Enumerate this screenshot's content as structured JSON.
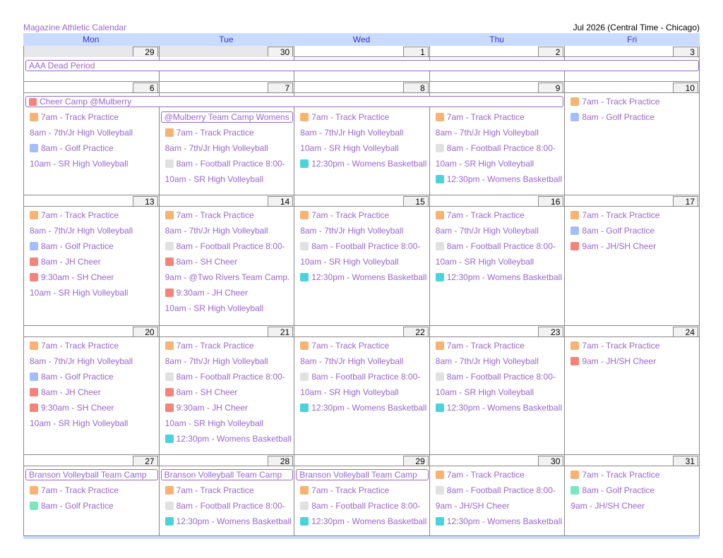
{
  "header": {
    "calendar_title": "Magazine Athletic Calendar",
    "month_label": "Jul 2026 (Central Time - Chicago)"
  },
  "days": [
    "Mon",
    "Tue",
    "Wed",
    "Thu",
    "Fri"
  ],
  "colors": {
    "orange": "#f8b273",
    "blue": "#a4bdfc",
    "gray": "#e1e1e1",
    "cyan": "#4bd3dc",
    "red": "#f4837a",
    "green": "#7ae7bf",
    "none": ""
  },
  "weeks": [
    {
      "dates": [
        "29",
        "30",
        "1",
        "2",
        "3"
      ],
      "other_month": [
        true,
        true,
        false,
        false,
        false
      ],
      "spans": [
        {
          "start": 0,
          "end": 4,
          "row": 0,
          "label": "AAA Dead Period",
          "color": "none"
        }
      ],
      "events": [
        [],
        [],
        [],
        [],
        []
      ]
    },
    {
      "dates": [
        "6",
        "7",
        "8",
        "9",
        "10"
      ],
      "other_month": [
        false,
        false,
        false,
        false,
        false
      ],
      "spans": [
        {
          "start": 0,
          "end": 3,
          "row": 0,
          "label": "Cheer Camp @Mulberry",
          "color": "red"
        },
        {
          "start": 1,
          "end": 1,
          "row": 1,
          "label": "@Mulberry Team Camp Womens",
          "color": "none"
        }
      ],
      "events": [
        [
          {
            "row": 1,
            "label": "7am - Track Practice",
            "color": "orange"
          },
          {
            "row": 2,
            "label": "8am - 7th/Jr High Volleyball",
            "color": "none"
          },
          {
            "row": 3,
            "label": "8am - Golf Practice",
            "color": "blue"
          },
          {
            "row": 4,
            "label": "10am - SR High Volleyball",
            "color": "none"
          }
        ],
        [
          {
            "row": 2,
            "label": "7am - Track Practice",
            "color": "orange"
          },
          {
            "row": 3,
            "label": "8am - 7th/Jr High Volleyball",
            "color": "none"
          },
          {
            "row": 4,
            "label": "8am - Football Practice 8:00-",
            "color": "gray"
          },
          {
            "row": 5,
            "label": "10am - SR High Volleyball",
            "color": "none"
          }
        ],
        [
          {
            "row": 1,
            "label": "7am - Track Practice",
            "color": "orange"
          },
          {
            "row": 2,
            "label": "8am - 7th/Jr High Volleyball",
            "color": "none"
          },
          {
            "row": 3,
            "label": "10am - SR High Volleyball",
            "color": "none"
          },
          {
            "row": 4,
            "label": "12:30pm - Womens Basketball",
            "color": "cyan"
          }
        ],
        [
          {
            "row": 1,
            "label": "7am - Track Practice",
            "color": "orange"
          },
          {
            "row": 2,
            "label": "8am - 7th/Jr High Volleyball",
            "color": "none"
          },
          {
            "row": 3,
            "label": "8am - Football Practice 8:00-",
            "color": "gray"
          },
          {
            "row": 4,
            "label": "10am - SR High Volleyball",
            "color": "none"
          },
          {
            "row": 5,
            "label": "12:30pm - Womens Basketball",
            "color": "cyan"
          }
        ],
        [
          {
            "row": 0,
            "label": "7am - Track Practice",
            "color": "orange"
          },
          {
            "row": 1,
            "label": "8am - Golf Practice",
            "color": "blue"
          }
        ]
      ]
    },
    {
      "dates": [
        "13",
        "14",
        "15",
        "16",
        "17"
      ],
      "other_month": [
        false,
        false,
        false,
        false,
        false
      ],
      "spans": [],
      "events": [
        [
          {
            "row": 0,
            "label": "7am - Track Practice",
            "color": "orange"
          },
          {
            "row": 1,
            "label": "8am - 7th/Jr High Volleyball",
            "color": "none"
          },
          {
            "row": 2,
            "label": "8am - Golf Practice",
            "color": "blue"
          },
          {
            "row": 3,
            "label": "8am - JH Cheer",
            "color": "red"
          },
          {
            "row": 4,
            "label": "9:30am - SH Cheer",
            "color": "red"
          },
          {
            "row": 5,
            "label": "10am - SR High Volleyball",
            "color": "none"
          }
        ],
        [
          {
            "row": 0,
            "label": "7am - Track Practice",
            "color": "orange"
          },
          {
            "row": 1,
            "label": "8am - 7th/Jr High Volleyball",
            "color": "none"
          },
          {
            "row": 2,
            "label": "8am - Football Practice 8:00-",
            "color": "gray"
          },
          {
            "row": 3,
            "label": "8am - SH Cheer",
            "color": "red"
          },
          {
            "row": 4,
            "label": "9am - @Two Rivers Team Camp.",
            "color": "none"
          },
          {
            "row": 5,
            "label": "9:30am - JH Cheer",
            "color": "red"
          },
          {
            "row": 6,
            "label": "10am - SR High Volleyball",
            "color": "none"
          }
        ],
        [
          {
            "row": 0,
            "label": "7am - Track Practice",
            "color": "orange"
          },
          {
            "row": 1,
            "label": "8am - 7th/Jr High Volleyball",
            "color": "none"
          },
          {
            "row": 2,
            "label": "8am - Football Practice 8:00-",
            "color": "gray"
          },
          {
            "row": 3,
            "label": "10am - SR High Volleyball",
            "color": "none"
          },
          {
            "row": 4,
            "label": "12:30pm - Womens Basketball",
            "color": "cyan"
          }
        ],
        [
          {
            "row": 0,
            "label": "7am - Track Practice",
            "color": "orange"
          },
          {
            "row": 1,
            "label": "8am - 7th/Jr High Volleyball",
            "color": "none"
          },
          {
            "row": 2,
            "label": "8am - Football Practice 8:00-",
            "color": "gray"
          },
          {
            "row": 3,
            "label": "10am - SR High Volleyball",
            "color": "none"
          },
          {
            "row": 4,
            "label": "12:30pm - Womens Basketball",
            "color": "cyan"
          }
        ],
        [
          {
            "row": 0,
            "label": "7am - Track Practice",
            "color": "orange"
          },
          {
            "row": 1,
            "label": "8am - Golf Practice",
            "color": "blue"
          },
          {
            "row": 2,
            "label": "9am - JH/SH Cheer",
            "color": "red"
          }
        ]
      ]
    },
    {
      "dates": [
        "20",
        "21",
        "22",
        "23",
        "24"
      ],
      "other_month": [
        false,
        false,
        false,
        false,
        false
      ],
      "spans": [],
      "events": [
        [
          {
            "row": 0,
            "label": "7am - Track Practice",
            "color": "orange"
          },
          {
            "row": 1,
            "label": "8am - 7th/Jr High Volleyball",
            "color": "none"
          },
          {
            "row": 2,
            "label": "8am - Golf Practice",
            "color": "blue"
          },
          {
            "row": 3,
            "label": "8am - JH Cheer",
            "color": "red"
          },
          {
            "row": 4,
            "label": "9:30am - SH Cheer",
            "color": "red"
          },
          {
            "row": 5,
            "label": "10am - SR High Volleyball",
            "color": "none"
          }
        ],
        [
          {
            "row": 0,
            "label": "7am - Track Practice",
            "color": "orange"
          },
          {
            "row": 1,
            "label": "8am - 7th/Jr High Volleyball",
            "color": "none"
          },
          {
            "row": 2,
            "label": "8am - Football Practice 8:00-",
            "color": "gray"
          },
          {
            "row": 3,
            "label": "8am - SH Cheer",
            "color": "red"
          },
          {
            "row": 4,
            "label": "9:30am - JH Cheer",
            "color": "red"
          },
          {
            "row": 5,
            "label": "10am - SR High Volleyball",
            "color": "none"
          },
          {
            "row": 6,
            "label": "12:30pm - Womens Basketball",
            "color": "cyan"
          }
        ],
        [
          {
            "row": 0,
            "label": "7am - Track Practice",
            "color": "orange"
          },
          {
            "row": 1,
            "label": "8am - 7th/Jr High Volleyball",
            "color": "none"
          },
          {
            "row": 2,
            "label": "8am - Football Practice 8:00-",
            "color": "gray"
          },
          {
            "row": 3,
            "label": "10am - SR High Volleyball",
            "color": "none"
          },
          {
            "row": 4,
            "label": "12:30pm - Womens Basketball",
            "color": "cyan"
          }
        ],
        [
          {
            "row": 0,
            "label": "7am - Track Practice",
            "color": "orange"
          },
          {
            "row": 1,
            "label": "8am - 7th/Jr High Volleyball",
            "color": "none"
          },
          {
            "row": 2,
            "label": "8am - Football Practice 8:00-",
            "color": "gray"
          },
          {
            "row": 3,
            "label": "10am - SR High Volleyball",
            "color": "none"
          },
          {
            "row": 4,
            "label": "12:30pm - Womens Basketball",
            "color": "cyan"
          }
        ],
        [
          {
            "row": 0,
            "label": "7am - Track Practice",
            "color": "orange"
          },
          {
            "row": 1,
            "label": "9am - JH/SH Cheer",
            "color": "red"
          }
        ]
      ]
    },
    {
      "dates": [
        "27",
        "28",
        "29",
        "30",
        "31"
      ],
      "other_month": [
        false,
        false,
        false,
        false,
        false
      ],
      "spans": [
        {
          "start": 0,
          "end": 0,
          "row": 0,
          "label": "Branson Volleyball Team Camp",
          "color": "none"
        },
        {
          "start": 1,
          "end": 1,
          "row": 0,
          "label": "Branson Volleyball Team Camp",
          "color": "none"
        },
        {
          "start": 2,
          "end": 2,
          "row": 0,
          "label": "Branson Volleyball Team Camp",
          "color": "none"
        }
      ],
      "events": [
        [
          {
            "row": 1,
            "label": "7am - Track Practice",
            "color": "orange"
          },
          {
            "row": 2,
            "label": "8am - Golf Practice",
            "color": "green"
          }
        ],
        [
          {
            "row": 1,
            "label": "7am - Track Practice",
            "color": "orange"
          },
          {
            "row": 2,
            "label": "8am - Football Practice 8:00-",
            "color": "gray"
          },
          {
            "row": 3,
            "label": "12:30pm - Womens Basketball",
            "color": "cyan"
          }
        ],
        [
          {
            "row": 1,
            "label": "7am - Track Practice",
            "color": "orange"
          },
          {
            "row": 2,
            "label": "8am - Football Practice 8:00-",
            "color": "gray"
          },
          {
            "row": 3,
            "label": "12:30pm - Womens Basketball",
            "color": "cyan"
          }
        ],
        [
          {
            "row": 0,
            "label": "7am - Track Practice",
            "color": "orange"
          },
          {
            "row": 1,
            "label": "8am - Football Practice 8:00-",
            "color": "gray"
          },
          {
            "row": 2,
            "label": "9am - JH/SH Cheer",
            "color": "none"
          },
          {
            "row": 3,
            "label": "12:30pm - Womens Basketball",
            "color": "cyan"
          }
        ],
        [
          {
            "row": 0,
            "label": "7am - Track Practice",
            "color": "orange"
          },
          {
            "row": 1,
            "label": "8am - Golf Practice",
            "color": "green"
          },
          {
            "row": 2,
            "label": "9am - JH/SH Cheer",
            "color": "none"
          }
        ]
      ]
    }
  ]
}
